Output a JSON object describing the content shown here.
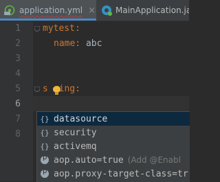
{
  "tabs": [
    {
      "label": "application.yml",
      "icon": "yaml-file-icon",
      "active": true
    },
    {
      "label": "MainApplication.java",
      "icon": "java-class-icon",
      "active": false
    }
  ],
  "close_glyph": "×",
  "line_numbers": [
    "1",
    "2",
    "3",
    "4",
    "5",
    "6",
    "7",
    "8"
  ],
  "code": {
    "line1_key": "mytest:",
    "line2_key": "name:",
    "line2_value": " abc",
    "line5_key_a": "s",
    "line5_key_b": "ring:"
  },
  "completion": {
    "items": [
      {
        "icon": "{}",
        "label": "datasource",
        "hint": "",
        "selected": true
      },
      {
        "icon": "{}",
        "label": "security",
        "hint": "",
        "selected": false
      },
      {
        "icon": "{}",
        "label": "activemq",
        "hint": "",
        "selected": false
      },
      {
        "icon": "p",
        "label": "aop.auto=true",
        "hint": "(Add @Enabl",
        "selected": false
      },
      {
        "icon": "p",
        "label": "aop.proxy-target-class=tr",
        "hint": "",
        "selected": false
      }
    ]
  },
  "colors": {
    "background": "#2b2b2b",
    "key": "#cc7832",
    "selection": "#0d293e",
    "tab_accent": "#4a88c7"
  }
}
